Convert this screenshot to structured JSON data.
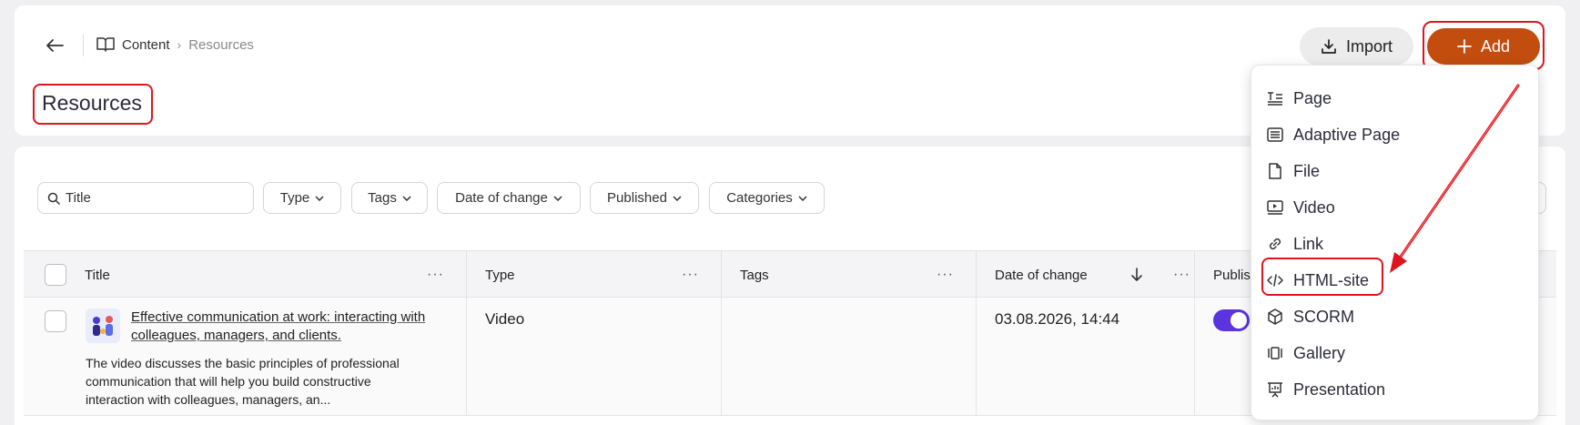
{
  "breadcrumb": {
    "items": [
      "Content",
      "Resources"
    ]
  },
  "page": {
    "title": "Resources"
  },
  "actions": {
    "import_label": "Import",
    "add_label": "Add"
  },
  "filters": {
    "search_placeholder": "Title",
    "buttons": [
      "Type",
      "Tags",
      "Date of change",
      "Published",
      "Categories"
    ]
  },
  "table": {
    "columns": [
      "Title",
      "Type",
      "Tags",
      "Date of change",
      "Publis"
    ],
    "rows": [
      {
        "title": "Effective communication at work: interacting with colleagues, managers, and clients.",
        "description": "The video discusses the basic principles of professional communication that will help you build constructive interaction with colleagues, managers, an...",
        "type": "Video",
        "tags": "",
        "date": "03.08.2026, 14:44",
        "published": true
      }
    ]
  },
  "add_menu": {
    "items": [
      {
        "label": "Page",
        "icon": "page-icon"
      },
      {
        "label": "Adaptive Page",
        "icon": "adaptive-page-icon"
      },
      {
        "label": "File",
        "icon": "file-icon"
      },
      {
        "label": "Video",
        "icon": "video-icon"
      },
      {
        "label": "Link",
        "icon": "link-icon"
      },
      {
        "label": "HTML-site",
        "icon": "code-icon"
      },
      {
        "label": "SCORM",
        "icon": "cube-icon"
      },
      {
        "label": "Gallery",
        "icon": "gallery-icon"
      },
      {
        "label": "Presentation",
        "icon": "presentation-icon"
      }
    ]
  },
  "colors": {
    "accent": "#c24d0f",
    "toggle_on": "#5b34e0",
    "annotation": "#e0141e"
  }
}
